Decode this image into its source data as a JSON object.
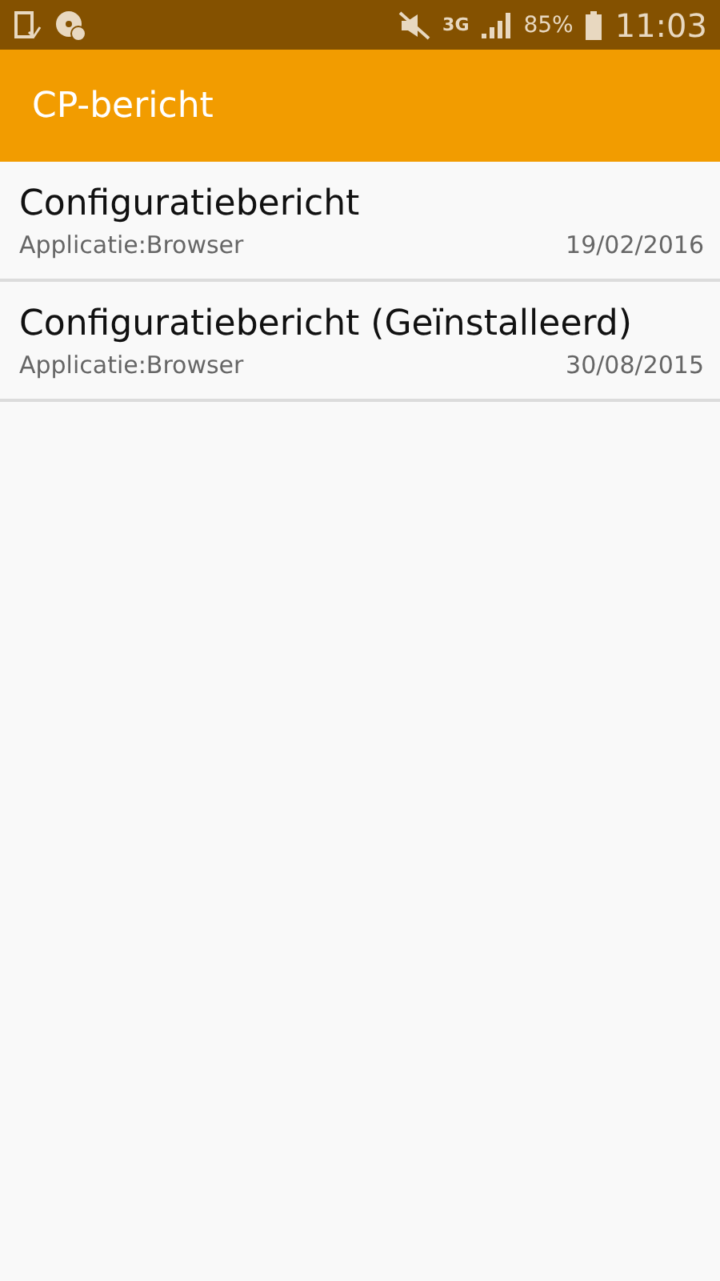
{
  "status_bar": {
    "network": "3G",
    "battery": "85%",
    "time": "11:03"
  },
  "app_bar": {
    "title": "CP-bericht"
  },
  "messages": [
    {
      "title": "Configuratiebericht",
      "subtitle": "Applicatie:Browser",
      "date": "19/02/2016"
    },
    {
      "title": "Configuratiebericht (Geïnstalleerd)",
      "subtitle": "Applicatie:Browser",
      "date": "30/08/2015"
    }
  ]
}
